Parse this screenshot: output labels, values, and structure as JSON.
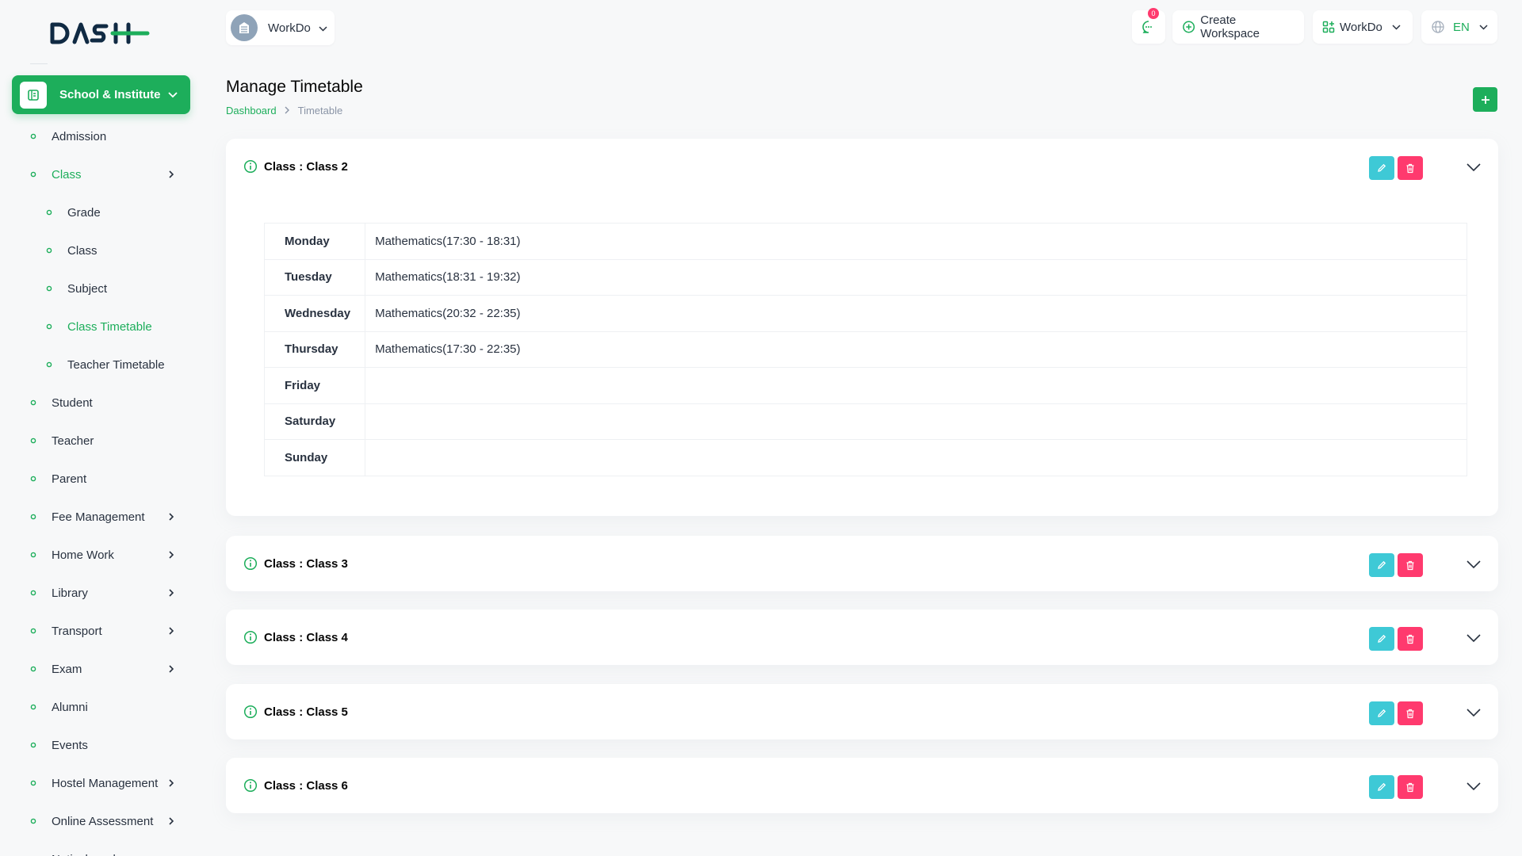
{
  "sidebar": {
    "logo": "DASH",
    "module": "School & Institute",
    "items": [
      {
        "label": "Admission",
        "sub": false,
        "active": false,
        "arrow": false
      },
      {
        "label": "Class",
        "sub": false,
        "active": true,
        "arrow": true
      },
      {
        "label": "Grade",
        "sub": true,
        "active": false,
        "arrow": false
      },
      {
        "label": "Class",
        "sub": true,
        "active": false,
        "arrow": false
      },
      {
        "label": "Subject",
        "sub": true,
        "active": false,
        "arrow": false
      },
      {
        "label": "Class Timetable",
        "sub": true,
        "active": true,
        "arrow": false
      },
      {
        "label": "Teacher Timetable",
        "sub": true,
        "active": false,
        "arrow": false
      },
      {
        "label": "Student",
        "sub": false,
        "active": false,
        "arrow": false
      },
      {
        "label": "Teacher",
        "sub": false,
        "active": false,
        "arrow": false
      },
      {
        "label": "Parent",
        "sub": false,
        "active": false,
        "arrow": false
      },
      {
        "label": "Fee Management",
        "sub": false,
        "active": false,
        "arrow": true
      },
      {
        "label": "Home Work",
        "sub": false,
        "active": false,
        "arrow": true
      },
      {
        "label": "Library",
        "sub": false,
        "active": false,
        "arrow": true
      },
      {
        "label": "Transport",
        "sub": false,
        "active": false,
        "arrow": true
      },
      {
        "label": "Exam",
        "sub": false,
        "active": false,
        "arrow": true
      },
      {
        "label": "Alumni",
        "sub": false,
        "active": false,
        "arrow": false
      },
      {
        "label": "Events",
        "sub": false,
        "active": false,
        "arrow": false
      },
      {
        "label": "Hostel Management",
        "sub": false,
        "active": false,
        "arrow": true
      },
      {
        "label": "Online Assessment",
        "sub": false,
        "active": false,
        "arrow": true
      },
      {
        "label": "Noticeboard",
        "sub": false,
        "active": false,
        "arrow": false
      }
    ]
  },
  "header": {
    "workspace_name": "WorkDo",
    "notification_count": "0",
    "create_workspace": "Create Workspace",
    "workspace_switch": "WorkDo",
    "language": "EN"
  },
  "page": {
    "title": "Manage Timetable",
    "breadcrumb_home": "Dashboard",
    "breadcrumb_current": "Timetable"
  },
  "timetables": [
    {
      "title": "Class : Class 2",
      "expanded": true,
      "rows": [
        {
          "day": "Monday",
          "entry": "Mathematics(17:30 - 18:31)"
        },
        {
          "day": "Tuesday",
          "entry": "Mathematics(18:31 - 19:32)"
        },
        {
          "day": "Wednesday",
          "entry": "Mathematics(20:32 - 22:35)"
        },
        {
          "day": "Thursday",
          "entry": "Mathematics(17:30 - 22:35)"
        },
        {
          "day": "Friday",
          "entry": ""
        },
        {
          "day": "Saturday",
          "entry": ""
        },
        {
          "day": "Sunday",
          "entry": ""
        }
      ]
    },
    {
      "title": "Class : Class 3",
      "expanded": false,
      "rows": []
    },
    {
      "title": "Class : Class 4",
      "expanded": false,
      "rows": []
    },
    {
      "title": "Class : Class 5",
      "expanded": false,
      "rows": []
    },
    {
      "title": "Class : Class 6",
      "expanded": false,
      "rows": []
    }
  ],
  "colors": {
    "primary": "#1dae5b",
    "edit": "#3ec9d6",
    "delete": "#ff3a6e"
  }
}
